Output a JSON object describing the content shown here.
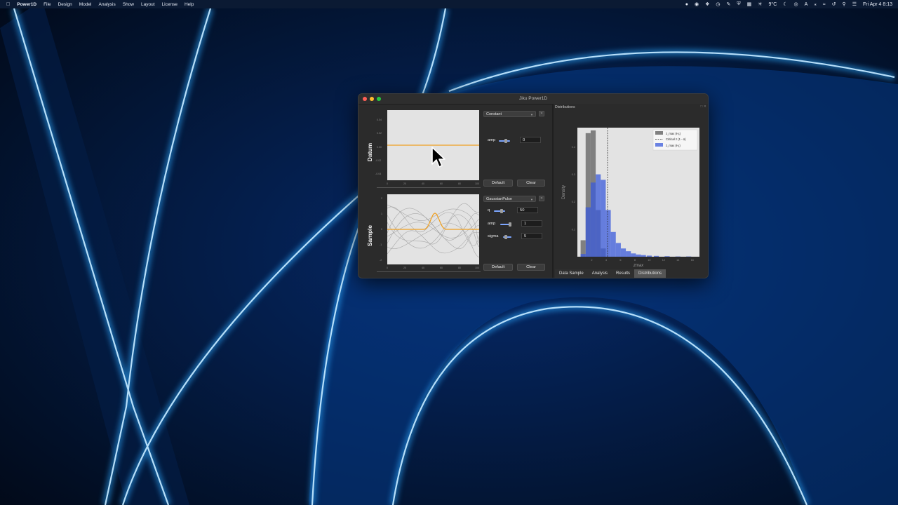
{
  "menubar": {
    "app_name": "Power1D",
    "items": [
      "File",
      "Design",
      "Model",
      "Analysis",
      "Show",
      "Layout",
      "License",
      "Help"
    ],
    "status_icons": [
      "circle-icon",
      "screen-record-icon",
      "dropbox-icon",
      "clock-icon",
      "pen-icon",
      "shield-icon",
      "grid-icon"
    ],
    "weather": "9°C",
    "clock": "Fri Apr 4  8:13"
  },
  "window": {
    "title": "Jiku Power1D",
    "traffic_colors": [
      "#ff5f57",
      "#febc2e",
      "#28c840"
    ]
  },
  "datum": {
    "label": "Datum",
    "model": "Constant",
    "params": [
      {
        "name": "amp",
        "value": "0",
        "slider": 0.5
      }
    ],
    "y_ticks": [
      "0.04",
      "0.02",
      "0.00",
      "-0.02",
      "-0.04"
    ],
    "x_ticks": [
      "0",
      "20",
      "40",
      "60",
      "80",
      "100"
    ],
    "default_label": "Default",
    "clear_label": "Clear"
  },
  "sample": {
    "label": "Sample",
    "model": "GaussianPulse",
    "params": [
      {
        "name": "q",
        "value": "50",
        "slider": 0.5
      },
      {
        "name": "amp",
        "value": "1",
        "slider": 0.75
      },
      {
        "name": "sigma",
        "value": "5",
        "slider": 0.2
      }
    ],
    "y_ticks": [
      "2",
      "1",
      "0",
      "-1",
      "-2"
    ],
    "x_ticks": [
      "0",
      "20",
      "40",
      "60",
      "80",
      "100"
    ],
    "default_label": "Default",
    "clear_label": "Clear"
  },
  "distributions": {
    "panel_title": "Distributions",
    "ylabel": "Density",
    "xlabel": "zmax",
    "x_ticks": [
      "2",
      "4",
      "6",
      "8",
      "10",
      "12",
      "14",
      "16"
    ],
    "y_ticks": [
      "0.4",
      "0.3",
      "0.2",
      "0.1"
    ],
    "legend": [
      "z_max (H₀)",
      "Critical z (1 - α)",
      "z_max (H₁)"
    ],
    "colors": {
      "h0": "#808080",
      "h1": "#3b5bdb",
      "critical": "#333333"
    }
  },
  "chart_data": {
    "type": "bar",
    "ylabel": "Density",
    "xlabel": "zmax",
    "xlim": [
      0,
      17
    ],
    "ylim": [
      0,
      0.47
    ],
    "critical_z": 4.2,
    "series": [
      {
        "name": "z_max (H₀)",
        "bin_width": 0.7,
        "x": [
          0.8,
          1.5,
          2.2,
          2.9,
          3.6
        ],
        "values": [
          0.06,
          0.45,
          0.46,
          0.17,
          0.03
        ]
      },
      {
        "name": "z_max (H₁)",
        "bin_width": 0.7,
        "x": [
          0.8,
          1.5,
          2.2,
          2.9,
          3.6,
          4.3,
          5.0,
          5.7,
          6.4,
          7.1,
          7.8,
          8.5,
          9.2,
          10.0,
          11.0,
          12.5,
          14.0,
          15.5
        ],
        "values": [
          0.01,
          0.18,
          0.27,
          0.3,
          0.28,
          0.17,
          0.09,
          0.05,
          0.03,
          0.02,
          0.012,
          0.008,
          0.006,
          0.004,
          0.003,
          0.002,
          0.001,
          0.001
        ]
      }
    ]
  },
  "tabs": [
    {
      "label": "Data Sample",
      "active": false
    },
    {
      "label": "Analysis",
      "active": false
    },
    {
      "label": "Results",
      "active": false
    },
    {
      "label": "Distributions",
      "active": true
    }
  ]
}
